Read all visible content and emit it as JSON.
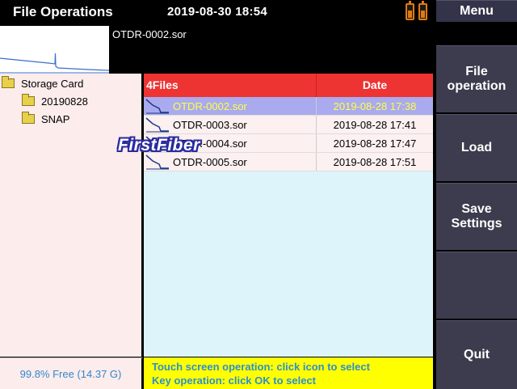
{
  "header": {
    "title": "File Operations",
    "datetime": "2019-08-30  18:54"
  },
  "preview": {
    "filename": "OTDR-0002.sor"
  },
  "tree": {
    "root": "Storage Card",
    "children": [
      "20190828",
      "SNAP"
    ]
  },
  "free_space": "99.8% Free (14.37 G)",
  "file_list": {
    "count_label": "4Files",
    "date_header": "Date",
    "rows": [
      {
        "name": "OTDR-0002.sor",
        "date": "2019-08-28 17:38",
        "selected": true
      },
      {
        "name": "OTDR-0003.sor",
        "date": "2019-08-28 17:41",
        "selected": false
      },
      {
        "name": "OTDR-0004.sor",
        "date": "2019-08-28 17:47",
        "selected": false
      },
      {
        "name": "OTDR-0005.sor",
        "date": "2019-08-28 17:51",
        "selected": false
      }
    ]
  },
  "watermark": "FirstFiber",
  "hints": {
    "line1": "Touch screen operation: click icon to select",
    "line2": "Key operation: click OK to select"
  },
  "menu": {
    "header": "Menu",
    "file_operation": "File\noperation",
    "load": "Load",
    "save_settings": "Save\nSettings",
    "quit": "Quit"
  },
  "colors": {
    "list_header": "#ee3333",
    "selected_row": "#aaaaee",
    "selected_text": "#ffff44",
    "hint_bar": "#ffff00",
    "hint_text": "#2d8fd0",
    "menu_button": "#3c3c4e",
    "battery": "#e07a10"
  },
  "icons": {
    "battery": "battery-icon",
    "folder": "folder-icon",
    "trace_file": "otdr-trace-file-icon"
  }
}
